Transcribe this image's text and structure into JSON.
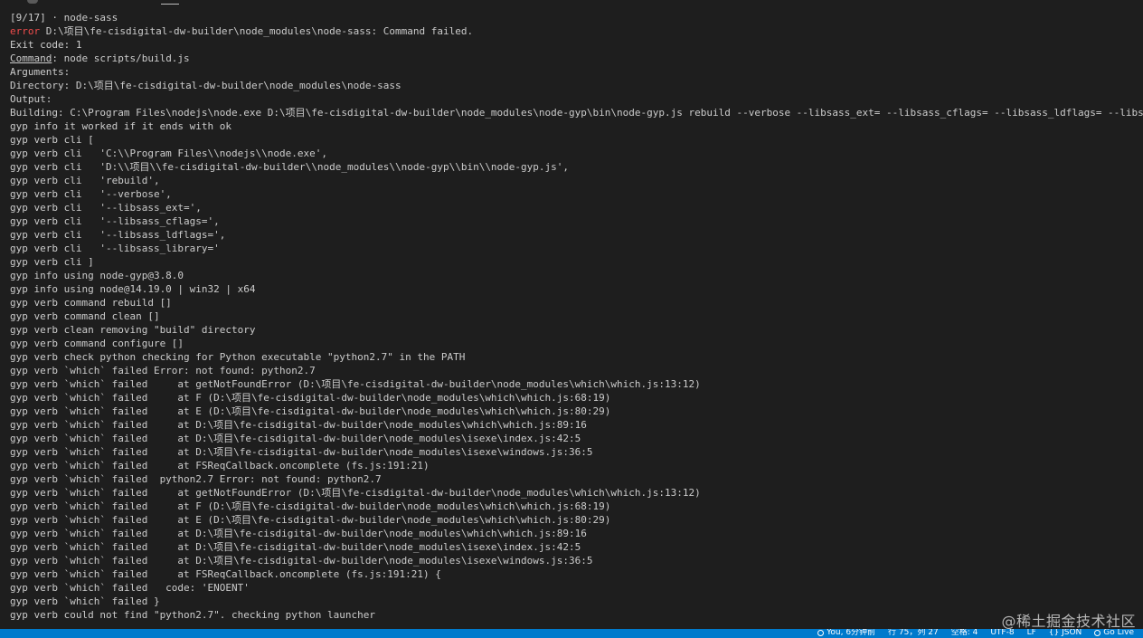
{
  "terminal": {
    "lines": [
      {
        "prefix": "[9/17] ",
        "text": "node-sass",
        "dot": "· "
      },
      {
        "err": "error",
        "text": " D:\\项目\\fe-cisdigital-dw-builder\\node_modules\\node-sass: Command failed."
      },
      {
        "text": "Exit code: 1"
      },
      {
        "u": "Command",
        "text": ": node scripts/build.js"
      },
      {
        "text": "Arguments:"
      },
      {
        "text": "Directory: D:\\项目\\fe-cisdigital-dw-builder\\node_modules\\node-sass"
      },
      {
        "text": "Output:"
      },
      {
        "text": "Building: C:\\Program Files\\nodejs\\node.exe D:\\项目\\fe-cisdigital-dw-builder\\node_modules\\node-gyp\\bin\\node-gyp.js rebuild --verbose --libsass_ext= --libsass_cflags= --libsass_ldflags= --libsass_library="
      },
      {
        "text": "gyp info it worked if it ends with ok"
      },
      {
        "text": "gyp verb cli ["
      },
      {
        "text": "gyp verb cli   'C:\\\\Program Files\\\\nodejs\\\\node.exe',"
      },
      {
        "text": "gyp verb cli   'D:\\\\项目\\\\fe-cisdigital-dw-builder\\\\node_modules\\\\node-gyp\\\\bin\\\\node-gyp.js',"
      },
      {
        "text": "gyp verb cli   'rebuild',"
      },
      {
        "text": "gyp verb cli   '--verbose',"
      },
      {
        "text": "gyp verb cli   '--libsass_ext=',"
      },
      {
        "text": "gyp verb cli   '--libsass_cflags=',"
      },
      {
        "text": "gyp verb cli   '--libsass_ldflags=',"
      },
      {
        "text": "gyp verb cli   '--libsass_library='"
      },
      {
        "text": "gyp verb cli ]"
      },
      {
        "text": "gyp info using node-gyp@3.8.0"
      },
      {
        "text": "gyp info using node@14.19.0 | win32 | x64"
      },
      {
        "text": "gyp verb command rebuild []"
      },
      {
        "text": "gyp verb command clean []"
      },
      {
        "text": "gyp verb clean removing \"build\" directory"
      },
      {
        "text": "gyp verb command configure []"
      },
      {
        "text": "gyp verb check python checking for Python executable \"python2.7\" in the PATH"
      },
      {
        "text": "gyp verb `which` failed Error: not found: python2.7"
      },
      {
        "text": "gyp verb `which` failed     at getNotFoundError (D:\\项目\\fe-cisdigital-dw-builder\\node_modules\\which\\which.js:13:12)"
      },
      {
        "text": "gyp verb `which` failed     at F (D:\\项目\\fe-cisdigital-dw-builder\\node_modules\\which\\which.js:68:19)"
      },
      {
        "text": "gyp verb `which` failed     at E (D:\\项目\\fe-cisdigital-dw-builder\\node_modules\\which\\which.js:80:29)"
      },
      {
        "text": "gyp verb `which` failed     at D:\\项目\\fe-cisdigital-dw-builder\\node_modules\\which\\which.js:89:16"
      },
      {
        "text": "gyp verb `which` failed     at D:\\项目\\fe-cisdigital-dw-builder\\node_modules\\isexe\\index.js:42:5"
      },
      {
        "text": "gyp verb `which` failed     at D:\\项目\\fe-cisdigital-dw-builder\\node_modules\\isexe\\windows.js:36:5"
      },
      {
        "text": "gyp verb `which` failed     at FSReqCallback.oncomplete (fs.js:191:21)"
      },
      {
        "text": "gyp verb `which` failed  python2.7 Error: not found: python2.7"
      },
      {
        "text": "gyp verb `which` failed     at getNotFoundError (D:\\项目\\fe-cisdigital-dw-builder\\node_modules\\which\\which.js:13:12)"
      },
      {
        "text": "gyp verb `which` failed     at F (D:\\项目\\fe-cisdigital-dw-builder\\node_modules\\which\\which.js:68:19)"
      },
      {
        "text": "gyp verb `which` failed     at E (D:\\项目\\fe-cisdigital-dw-builder\\node_modules\\which\\which.js:80:29)"
      },
      {
        "text": "gyp verb `which` failed     at D:\\项目\\fe-cisdigital-dw-builder\\node_modules\\which\\which.js:89:16"
      },
      {
        "text": "gyp verb `which` failed     at D:\\项目\\fe-cisdigital-dw-builder\\node_modules\\isexe\\index.js:42:5"
      },
      {
        "text": "gyp verb `which` failed     at D:\\项目\\fe-cisdigital-dw-builder\\node_modules\\isexe\\windows.js:36:5"
      },
      {
        "text": "gyp verb `which` failed     at FSReqCallback.oncomplete (fs.js:191:21) {"
      },
      {
        "text": "gyp verb `which` failed   code: 'ENOENT'"
      },
      {
        "text": "gyp verb `which` failed }"
      },
      {
        "text": "gyp verb could not find \"python2.7\". checking python launcher"
      }
    ]
  },
  "statusbar": {
    "items": [
      {
        "icon": "git-blame-icon",
        "label": "You, 6分钟前"
      },
      {
        "label": "行 75，列 27"
      },
      {
        "label": "空格: 4"
      },
      {
        "label": "UTF-8"
      },
      {
        "label": "LF"
      },
      {
        "icon": "braces-icon",
        "label": "{} JSON"
      },
      {
        "icon": "broadcast-icon",
        "label": "Go Live"
      }
    ]
  },
  "watermark": "@稀土掘金技术社区",
  "colors": {
    "background": "#1e1e1e",
    "text": "#cccccc",
    "error": "#f14c4c",
    "statusbar": "#007acc"
  }
}
